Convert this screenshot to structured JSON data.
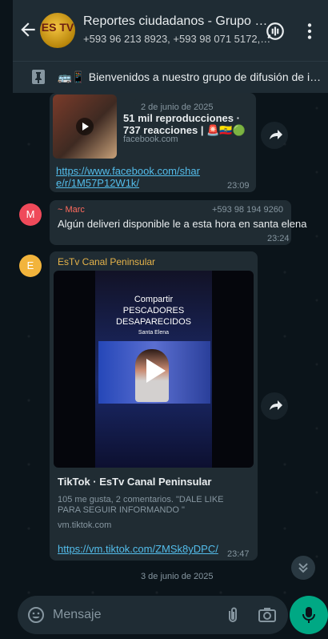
{
  "header": {
    "group_name": "Reportes ciudadanos - Grupo Oficial",
    "members": "+593 96 213 8923, +593 98 071 5172, ...",
    "avatar_text": "ES TV"
  },
  "pinned": {
    "text": "Bienvenidos a nuestro grupo de difusión de información"
  },
  "messages": [
    {
      "date": "2 de junio de 2025",
      "preview_title": "51 mil reproducciones · 737 reacciones | 🚨🇪🇨🟢 #A...",
      "domain": "facebook.com",
      "link": "https://www.facebook.com/share/r/1M57P12W1k/",
      "time": "23:09"
    },
    {
      "sender": "~ Marc",
      "sender_avatar": "M",
      "phone": "+593 98 194 9260",
      "text": "Algún deliveri disponible le a esta hora en santa elena",
      "time": "23:24"
    },
    {
      "sender": "EsTv Canal Peninsular",
      "sender_avatar": "E",
      "video_text_1": "Compartir",
      "video_text_2": "PESCADORES",
      "video_text_3": "DESAPARECIDOS",
      "video_text_4": "Santa Elena",
      "preview_title": "TikTok · EsTv Canal Peninsular",
      "description": "105 me gusta, 2 comentarios. \"DALE LIKE PARA SEGUIR INFORMANDO \"",
      "domain": "vm.tiktok.com",
      "link": "https://vm.tiktok.com/ZMSk8yDPC/",
      "time": "23:47"
    }
  ],
  "date_separator": "3 de junio de 2025",
  "composer": {
    "placeholder": "Mensaje"
  },
  "colors": {
    "background": "#0b141a",
    "header": "#1f2c34",
    "bubble": "#202c33",
    "accent": "#00a884",
    "link": "#53bdeb",
    "sender_marc": "#ff6b5e",
    "sender_estv": "#e5b34a"
  }
}
